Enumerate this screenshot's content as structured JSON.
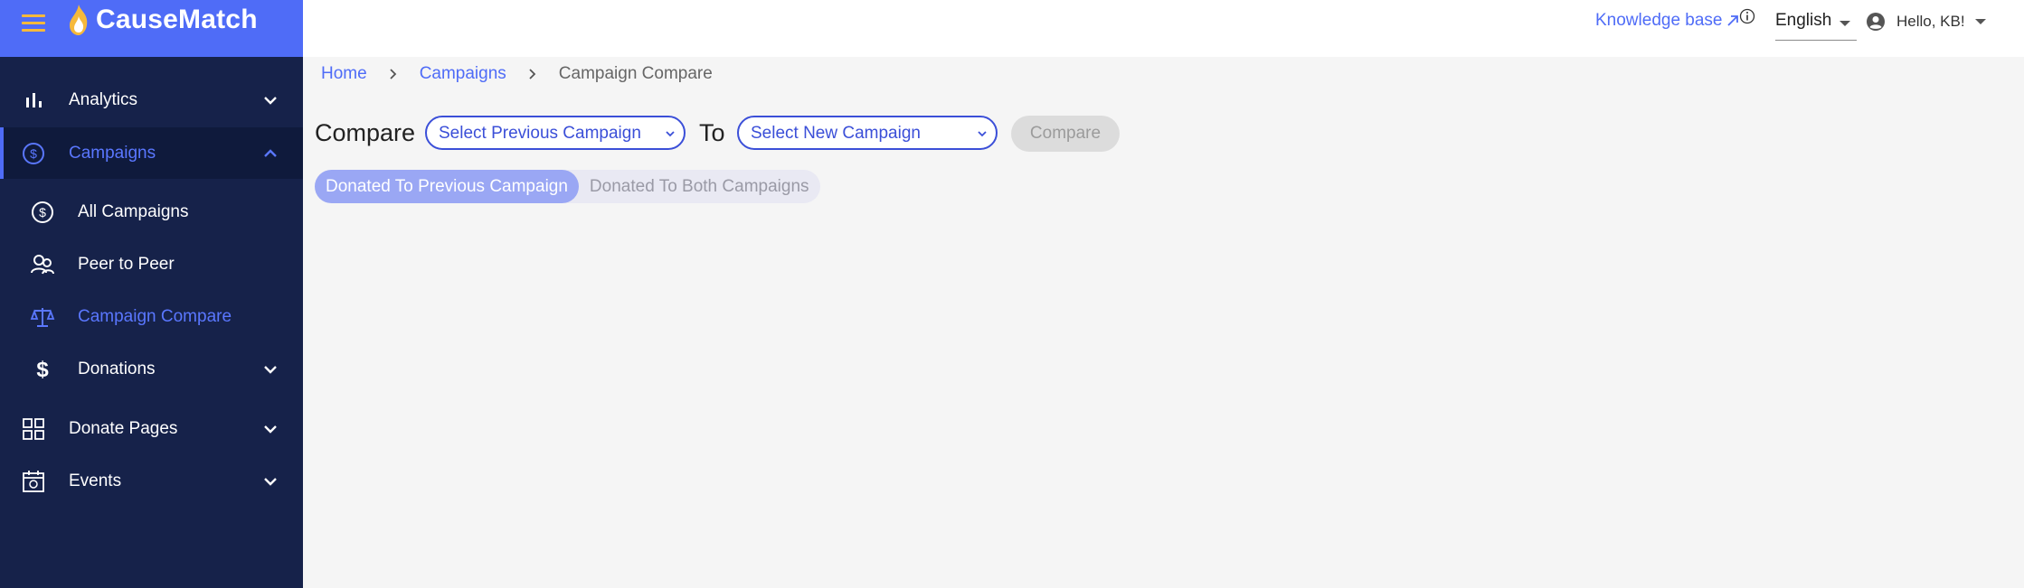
{
  "app": {
    "name": "CauseMatch"
  },
  "sidebar": {
    "items": [
      {
        "label": "Analytics",
        "icon": "bar-chart-icon"
      },
      {
        "label": "Campaigns",
        "icon": "dollar-circle-icon"
      },
      {
        "label": "All Campaigns",
        "icon": "dollar-circle-icon"
      },
      {
        "label": "Peer to Peer",
        "icon": "people-icon"
      },
      {
        "label": "Campaign Compare",
        "icon": "scale-icon"
      },
      {
        "label": "Donations",
        "icon": "dollar-sign-icon"
      },
      {
        "label": "Donate Pages",
        "icon": "grid-icon"
      },
      {
        "label": "Events",
        "icon": "calendar-icon"
      }
    ]
  },
  "topbar": {
    "knowledge_base": "Knowledge base",
    "language": "English",
    "greeting": "Hello, KB!"
  },
  "breadcrumb": {
    "items": [
      "Home",
      "Campaigns",
      "Campaign Compare"
    ]
  },
  "compare": {
    "label": "Compare",
    "to_label": "To",
    "previous_placeholder": "Select Previous Campaign",
    "new_placeholder": "Select New Campaign",
    "button": "Compare"
  },
  "filters": {
    "options": [
      "Donated To Previous Campaign",
      "Donated To Both Campaigns"
    ],
    "selected": "Donated To Previous Campaign"
  },
  "colors": {
    "sidebar_bg": "#16224a",
    "brand_bg": "#4f6cf7",
    "accent": "#4f6cf7",
    "content_bg": "#f5f5f5"
  }
}
